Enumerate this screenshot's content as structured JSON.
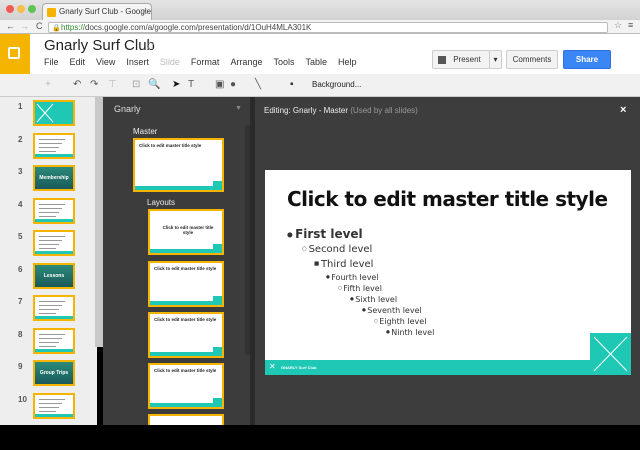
{
  "browser": {
    "tab_title": "Gnarly Surf Club - Google",
    "url_scheme": "https://",
    "url_rest": "docs.google.com/a/google.com/presentation/d/1OuH4MLA301K"
  },
  "doc": {
    "title": "Gnarly Surf Club",
    "menu": [
      "File",
      "Edit",
      "View",
      "Insert",
      "Slide",
      "Format",
      "Arrange",
      "Tools",
      "Table",
      "Help"
    ],
    "present_label": "Present",
    "comments_label": "Comments",
    "share_label": "Share",
    "background_label": "Background...",
    "share_color": "#3b86f5",
    "brand_color": "#f4b400"
  },
  "filmstrip": {
    "slides": [
      {
        "num": "1",
        "kind": "teal",
        "text": ""
      },
      {
        "num": "2",
        "kind": "text",
        "text": ""
      },
      {
        "num": "3",
        "kind": "photo",
        "text": "Membership"
      },
      {
        "num": "4",
        "kind": "list",
        "text": ""
      },
      {
        "num": "5",
        "kind": "table",
        "text": ""
      },
      {
        "num": "6",
        "kind": "photo",
        "text": "Lessons"
      },
      {
        "num": "7",
        "kind": "list",
        "text": ""
      },
      {
        "num": "8",
        "kind": "list",
        "text": ""
      },
      {
        "num": "9",
        "kind": "photo",
        "text": "Group Trips"
      },
      {
        "num": "10",
        "kind": "list",
        "text": ""
      }
    ]
  },
  "layouts_panel": {
    "theme_name": "Gnarly",
    "master_label": "Master",
    "layouts_label": "Layouts",
    "master_thumb_title": "Click to edit master title style",
    "layout_thumbs": [
      "Click to edit master title style",
      "Click to edit master title style",
      "Click to edit master title style",
      "Click to edit master title style"
    ]
  },
  "editor": {
    "title": "Editing: Gnarly - Master",
    "subtitle": "(Used by all slides)",
    "close_label": "×",
    "slide": {
      "title": "Click to edit master title style",
      "levels": [
        "First level",
        "Second level",
        "Third level",
        "Fourth level",
        "Fifth level",
        "Sixth level",
        "Seventh level",
        "Eighth level",
        "Ninth level"
      ],
      "footer": "GNARLY Surf Club",
      "accent_color": "#1ec8b4"
    }
  }
}
